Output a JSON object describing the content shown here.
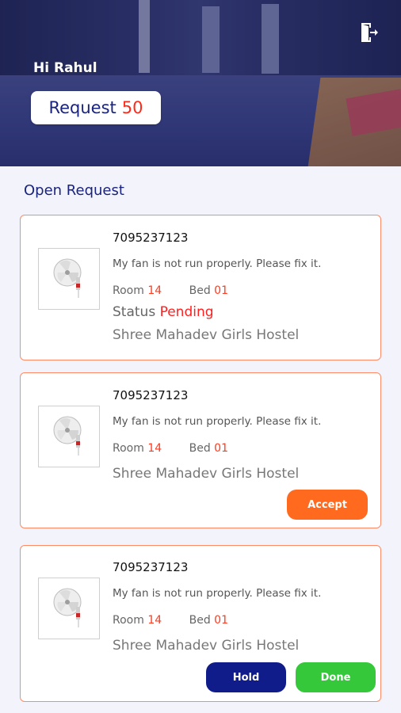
{
  "header": {
    "greeting": "Hi Rahul",
    "request_label": "Request",
    "request_count": "50",
    "logout_icon": "logout-icon"
  },
  "section": {
    "title": "Open Request"
  },
  "requests": [
    {
      "phone": "7095237123",
      "description": "My fan is not run properly. Please fix it.",
      "room_label": "Room",
      "room": "14",
      "bed_label": "Bed",
      "bed": "01",
      "status_label": "Status",
      "status": "Pending",
      "hostel": "Shree Mahadev Girls Hostel",
      "image_icon": "fan-icon"
    },
    {
      "phone": "7095237123",
      "description": "My fan is not run properly. Please fix it.",
      "room_label": "Room",
      "room": "14",
      "bed_label": "Bed",
      "bed": "01",
      "hostel": "Shree Mahadev Girls Hostel",
      "accept_label": "Accept",
      "image_icon": "fan-icon"
    },
    {
      "phone": "7095237123",
      "description": "My fan is not run properly. Please fix it.",
      "room_label": "Room",
      "room": "14",
      "bed_label": "Bed",
      "bed": "01",
      "hostel": "Shree Mahadev Girls Hostel",
      "hold_label": "Hold",
      "done_label": "Done",
      "image_icon": "fan-icon"
    }
  ],
  "colors": {
    "primary": "#1a237e",
    "accent": "#ff3b1f",
    "accept": "#ff6a1f",
    "hold": "#0f1c8a",
    "done": "#35c83a",
    "card_border": "#ff8a65"
  }
}
